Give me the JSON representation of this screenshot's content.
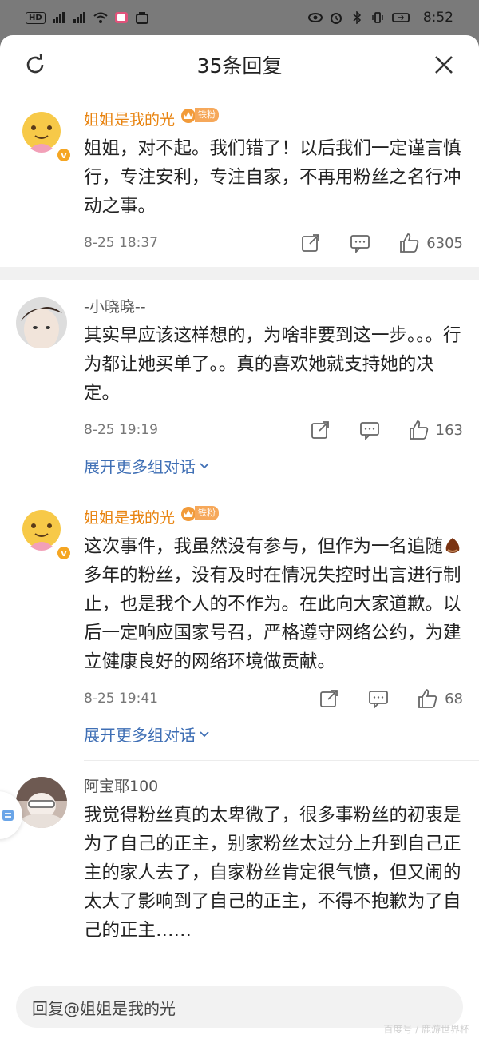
{
  "status_bar": {
    "left_chips": [
      "HD",
      "2",
      "4G",
      "4G"
    ],
    "time": "8:52"
  },
  "header": {
    "title": "35条回复"
  },
  "comments": [
    {
      "username": "姐姐是我的光",
      "fan_badge": "铁粉",
      "text": "姐姐，对不起。我们错了！以后我们一定谨言慎行，专注安利，专注自家，不再用粉丝之名行冲动之事。",
      "time": "8-25 18:37",
      "likes": "6305"
    },
    {
      "username": "-小晓晓--",
      "text": "其实早应该这样想的，为啥非要到这一步。。。行为都让她买单了。。真的喜欢她就支持她的决定。",
      "time": "8-25 19:19",
      "likes": "163",
      "expand_label": "展开更多组对话"
    },
    {
      "username": "姐姐是我的光",
      "fan_badge": "铁粉",
      "text_part1": "这次事件，我虽然没有参与，但作为一名追随",
      "text_part2": "多年的粉丝，没有及时在情况失控时出言进行制止，也是我个人的不作为。在此向大家道歉。以后一定响应国家号召，严格遵守网络公约，为建立健康良好的网络环境做贡献。",
      "time": "8-25 19:41",
      "likes": "68",
      "expand_label": "展开更多组对话"
    },
    {
      "username": "阿宝耶100",
      "text": "我觉得粉丝真的太卑微了，很多事粉丝的初衷是为了自己的正主，别家粉丝太过分上升到自己正主的家人去了，自家粉丝肯定很气愤，但又闹的太大了影响到了自己的正主，不得不抱歉为了自己的正主……"
    }
  ],
  "reply_bar": {
    "placeholder": "回复@姐姐是我的光"
  },
  "watermark": "百度号 / 鹿游世界杯",
  "colors": {
    "accent_orange": "#e8830f",
    "link_blue": "#3f6fb5"
  },
  "icons": [
    "refresh-icon",
    "close-icon",
    "share-icon",
    "comment-icon",
    "like-icon",
    "chevron-down-icon",
    "chestnut-emoji"
  ]
}
